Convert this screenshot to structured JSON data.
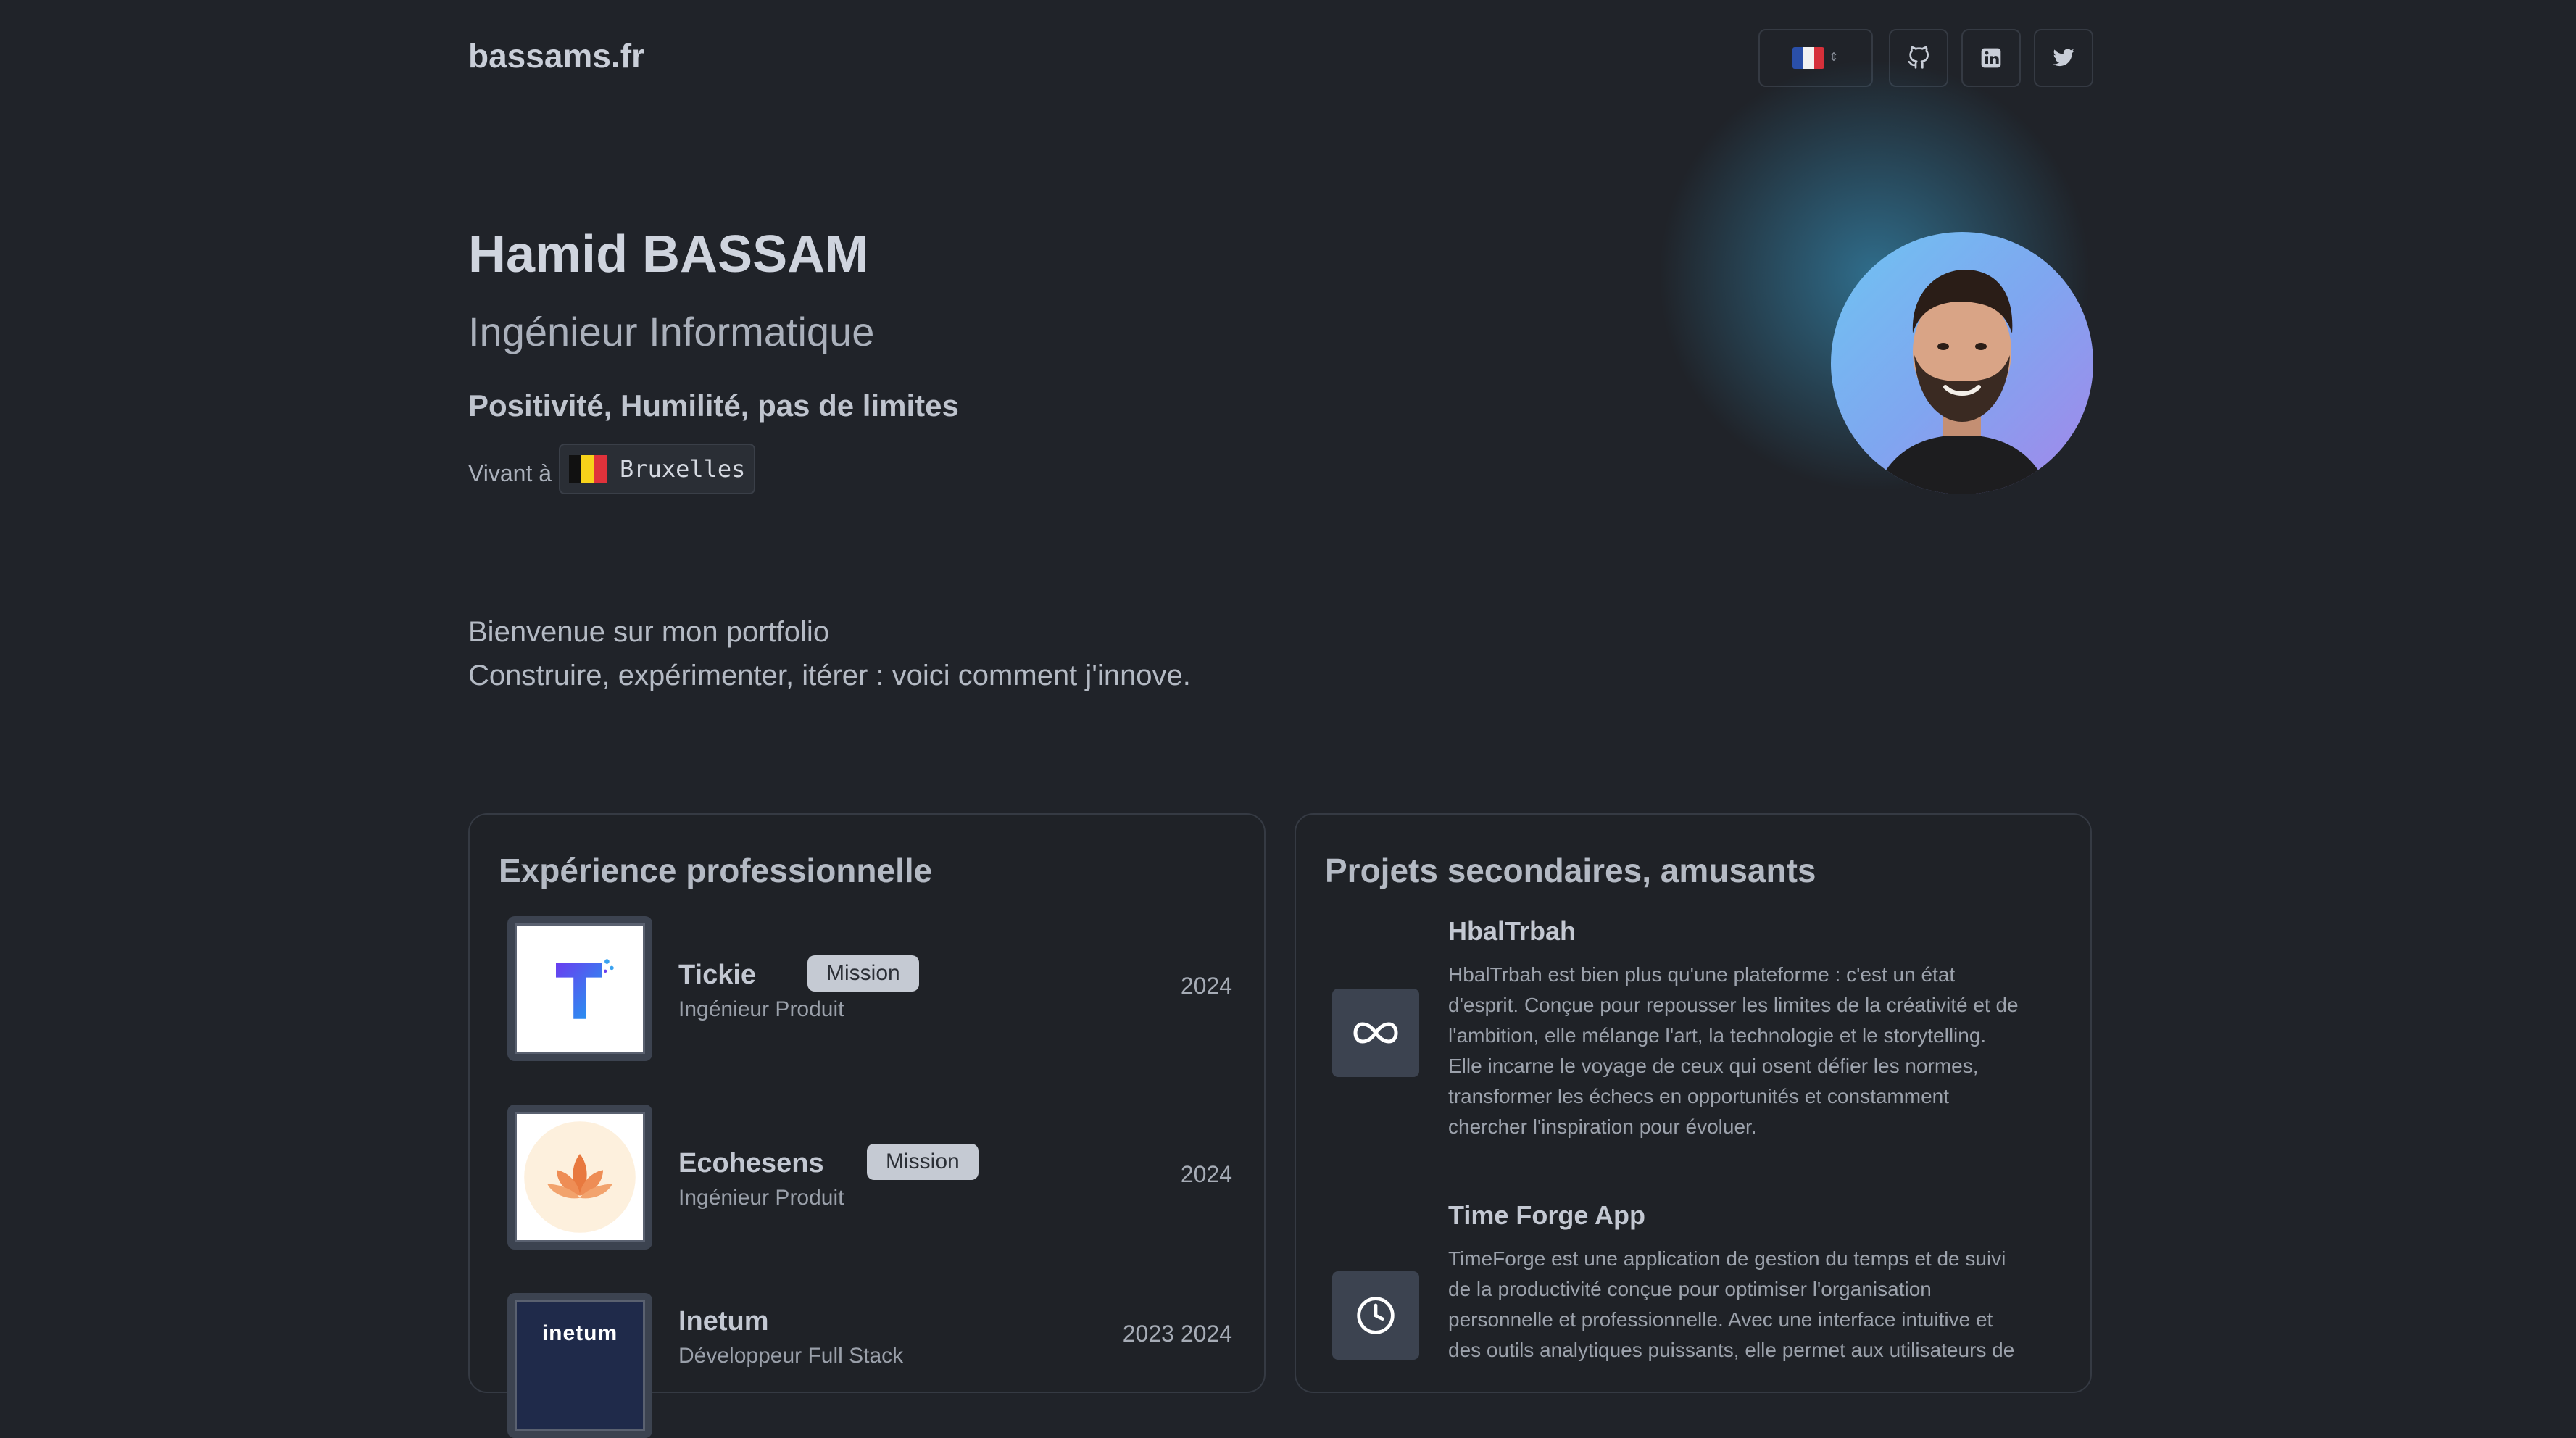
{
  "header": {
    "site_title": "bassams.fr",
    "language_flag": "fr",
    "icons": [
      "github-icon",
      "linkedin-icon",
      "twitter-icon"
    ]
  },
  "hero": {
    "name": "Hamid BASSAM",
    "role": "Ingénieur Informatique",
    "motto": "Positivité, Humilité, pas de limites",
    "living_label": "Vivant à",
    "city": "Bruxelles",
    "city_flag": "be"
  },
  "welcome": {
    "line1": "Bienvenue sur mon portfolio",
    "line2": "Construire, expérimenter, itérer : voici comment j'innove."
  },
  "experience": {
    "title": "Expérience professionnelle",
    "items": [
      {
        "company": "Tickie",
        "badge": "Mission",
        "role": "Ingénieur Produit",
        "year": "2024"
      },
      {
        "company": "Ecohesens",
        "badge": "Mission",
        "role": "Ingénieur Produit",
        "year": "2024"
      },
      {
        "company": "Inetum",
        "badge": "",
        "role": "Développeur Full Stack",
        "year": "2023 2024",
        "logo_text": "inetum"
      }
    ]
  },
  "projects": {
    "title": "Projets secondaires, amusants",
    "items": [
      {
        "name": "HbalTrbah",
        "icon": "infinity-icon",
        "lines": [
          "HbalTrbah est bien plus qu'une plateforme : c'est un état",
          "d'esprit. Conçue pour repousser les limites de la créativité et de",
          "l'ambition, elle mélange l'art, la technologie et le storytelling.",
          "Elle incarne le voyage de ceux qui osent défier les normes,",
          "transformer les échecs en opportunités et constamment",
          "chercher l'inspiration pour évoluer."
        ]
      },
      {
        "name": "Time Forge App",
        "icon": "clock-icon",
        "lines": [
          "TimeForge est une application de gestion du temps et de suivi",
          "de la productivité conçue pour optimiser l'organisation",
          "personnelle et professionnelle. Avec une interface intuitive et",
          "des outils analytiques puissants, elle permet aux utilisateurs de"
        ]
      }
    ]
  },
  "colors": {
    "background": "#202329",
    "card_border": "#353a43",
    "badge_bg": "#c5cad3",
    "avatar_gradient": [
      "#6fc4f2",
      "#a486ea"
    ]
  }
}
